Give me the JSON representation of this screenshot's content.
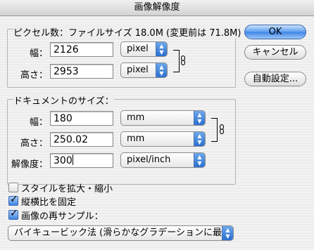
{
  "window": {
    "title": "画像解像度"
  },
  "pixel_dimensions": {
    "heading": "ピクセル数：ファイルサイズ 18.0M (変更前は 71.8M)",
    "width_label": "幅：",
    "width_value": "2126",
    "width_unit": "pixel",
    "height_label": "高さ：",
    "height_value": "2953",
    "height_unit": "pixel"
  },
  "document_size": {
    "heading": "ドキュメントのサイズ：",
    "width_label": "幅：",
    "width_value": "180",
    "width_unit": "mm",
    "height_label": "高さ：",
    "height_value": "250.02",
    "height_unit": "mm",
    "resolution_label": "解像度：",
    "resolution_value": "300",
    "resolution_unit": "pixel/inch"
  },
  "buttons": {
    "ok": "OK",
    "cancel": "キャンセル",
    "auto": "自動設定..."
  },
  "options": {
    "scale_styles": {
      "label": "スタイルを拡大・縮小",
      "checked": false
    },
    "constrain": {
      "label": "縦横比を固定",
      "checked": true
    },
    "resample": {
      "label": "画像の再サンプル：",
      "checked": true
    }
  },
  "resample_method": "バイキュービック法 (滑らかなグラデーションに最適)",
  "icons": {
    "popup_arrows": "up-down-arrows-icon",
    "link": "chain-link-icon",
    "checkmark": "checkmark-icon"
  }
}
